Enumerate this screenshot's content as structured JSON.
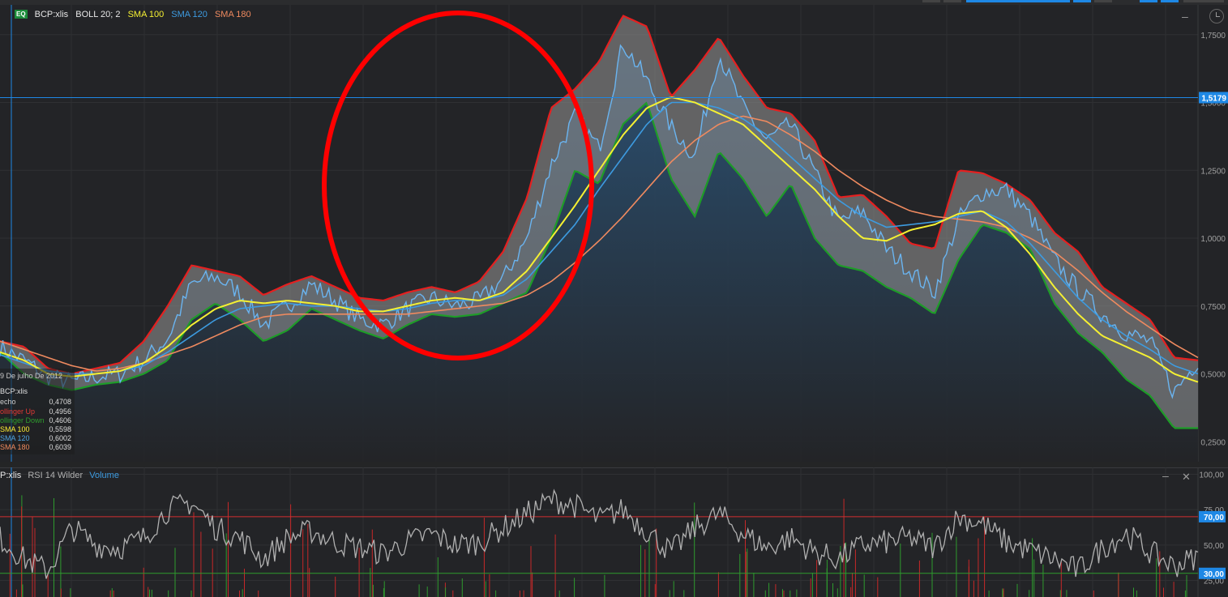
{
  "main_legend": {
    "badge": "EQ",
    "symbol": "BCP:xlis",
    "boll": "BOLL 20; 2",
    "sma100": "SMA 100",
    "sma120": "SMA 120",
    "sma180": "SMA 180"
  },
  "rsi_legend": {
    "symbol": "P:xlis",
    "rsi": "RSI 14 Wilder",
    "volume": "Volume"
  },
  "controls": {
    "minimize": "–",
    "close": "✕"
  },
  "tooltip": {
    "date": "9 De julho De 2012",
    "symbol": "BCP:xlis",
    "rows": [
      {
        "key": "echo",
        "value": "0,4708",
        "color": "#cccccc"
      },
      {
        "key": "ollinger Up",
        "value": "0,4956",
        "color": "#e53935"
      },
      {
        "key": "ollinger Down",
        "value": "0,4606",
        "color": "#2e9b2e"
      },
      {
        "key": "SMA 100",
        "value": "0,5598",
        "color": "#ffee33"
      },
      {
        "key": "SMA 120",
        "value": "0,6002",
        "color": "#4fa3e0"
      },
      {
        "key": "SMA 180",
        "value": "0,6039",
        "color": "#f08a5d"
      }
    ]
  },
  "colors": {
    "price": "#6ab4f0",
    "boll_up": "#e52020",
    "boll_down": "#1e9c28",
    "band_fill": "#8a8a8a",
    "sma100": "#f5f032",
    "sma120": "#3d9be0",
    "sma180": "#ef8a5f",
    "rsi": "#b0b0b0",
    "annotation": "#ff0000",
    "crosshair": "#1e88e5"
  },
  "chart_data": [
    {
      "type": "line",
      "title": "BCP:xlis",
      "ylim": [
        0.2,
        1.8
      ],
      "yticks": [
        "1,7500",
        "1,5000",
        "1,2500",
        "1,0000",
        "0,7500",
        "0,5000",
        "0,2500"
      ],
      "yticks_values": [
        1.75,
        1.5,
        1.25,
        1.0,
        0.75,
        0.5,
        0.25
      ],
      "last_price_label": "1,5179",
      "last_price": 1.5179,
      "x": [
        0,
        2,
        4,
        6,
        8,
        10,
        12,
        14,
        16,
        18,
        20,
        22,
        24,
        26,
        28,
        30,
        32,
        34,
        36,
        38,
        40,
        42,
        44,
        46,
        48,
        50,
        52,
        54,
        56,
        58,
        60,
        62,
        64,
        66,
        68,
        70,
        72,
        74,
        76,
        78,
        80,
        82,
        84,
        86,
        88,
        90,
        92,
        94,
        96,
        98,
        100
      ],
      "series": [
        {
          "name": "BCP:xlis",
          "values": [
            0.6,
            0.55,
            0.49,
            0.47,
            0.49,
            0.5,
            0.55,
            0.63,
            0.83,
            0.86,
            0.8,
            0.68,
            0.75,
            0.83,
            0.77,
            0.7,
            0.68,
            0.74,
            0.78,
            0.75,
            0.77,
            0.85,
            1.0,
            1.27,
            1.45,
            1.33,
            1.72,
            1.58,
            1.41,
            1.3,
            1.68,
            1.48,
            1.36,
            1.42,
            1.24,
            1.06,
            1.1,
            0.96,
            0.88,
            0.8,
            1.07,
            1.17,
            1.18,
            1.08,
            0.92,
            0.81,
            0.72,
            0.65,
            0.62,
            0.43,
            0.55
          ]
        },
        {
          "name": "Bollinger Up",
          "values": [
            0.62,
            0.6,
            0.52,
            0.5,
            0.52,
            0.54,
            0.62,
            0.75,
            0.9,
            0.88,
            0.86,
            0.79,
            0.83,
            0.86,
            0.82,
            0.78,
            0.77,
            0.8,
            0.82,
            0.8,
            0.84,
            0.95,
            1.15,
            1.48,
            1.55,
            1.65,
            1.82,
            1.78,
            1.52,
            1.62,
            1.74,
            1.6,
            1.48,
            1.46,
            1.36,
            1.15,
            1.16,
            1.08,
            0.98,
            0.96,
            1.25,
            1.24,
            1.2,
            1.14,
            1.02,
            0.95,
            0.82,
            0.76,
            0.7,
            0.56,
            0.55
          ]
        },
        {
          "name": "Bollinger Down",
          "values": [
            0.58,
            0.5,
            0.46,
            0.44,
            0.46,
            0.47,
            0.5,
            0.55,
            0.7,
            0.76,
            0.7,
            0.62,
            0.66,
            0.74,
            0.7,
            0.66,
            0.63,
            0.68,
            0.72,
            0.71,
            0.72,
            0.76,
            0.8,
            1.0,
            1.25,
            1.2,
            1.42,
            1.5,
            1.22,
            1.08,
            1.32,
            1.22,
            1.08,
            1.2,
            1.0,
            0.9,
            0.88,
            0.82,
            0.78,
            0.72,
            0.92,
            1.05,
            1.02,
            0.96,
            0.76,
            0.65,
            0.58,
            0.48,
            0.42,
            0.3,
            0.3
          ]
        },
        {
          "name": "SMA 100",
          "values": [
            0.58,
            0.55,
            0.5,
            0.49,
            0.5,
            0.51,
            0.54,
            0.6,
            0.68,
            0.74,
            0.77,
            0.76,
            0.77,
            0.76,
            0.75,
            0.73,
            0.73,
            0.75,
            0.77,
            0.78,
            0.77,
            0.8,
            0.88,
            1.0,
            1.12,
            1.25,
            1.38,
            1.48,
            1.52,
            1.5,
            1.46,
            1.42,
            1.34,
            1.26,
            1.18,
            1.08,
            1.0,
            0.99,
            1.03,
            1.05,
            1.09,
            1.1,
            1.04,
            0.94,
            0.82,
            0.72,
            0.64,
            0.6,
            0.56,
            0.5,
            0.47
          ]
        },
        {
          "name": "SMA 120",
          "values": [
            0.57,
            0.54,
            0.51,
            0.5,
            0.5,
            0.51,
            0.53,
            0.58,
            0.64,
            0.7,
            0.74,
            0.75,
            0.76,
            0.75,
            0.75,
            0.74,
            0.73,
            0.74,
            0.76,
            0.77,
            0.77,
            0.79,
            0.85,
            0.95,
            1.05,
            1.18,
            1.3,
            1.42,
            1.5,
            1.5,
            1.48,
            1.44,
            1.38,
            1.3,
            1.22,
            1.14,
            1.08,
            1.04,
            1.05,
            1.06,
            1.08,
            1.1,
            1.06,
            0.98,
            0.88,
            0.78,
            0.7,
            0.64,
            0.59,
            0.53,
            0.5
          ]
        },
        {
          "name": "SMA 180",
          "values": [
            0.62,
            0.59,
            0.56,
            0.53,
            0.51,
            0.52,
            0.54,
            0.57,
            0.6,
            0.64,
            0.68,
            0.71,
            0.72,
            0.72,
            0.72,
            0.72,
            0.72,
            0.72,
            0.73,
            0.74,
            0.75,
            0.76,
            0.79,
            0.84,
            0.91,
            0.99,
            1.08,
            1.18,
            1.28,
            1.36,
            1.42,
            1.45,
            1.43,
            1.38,
            1.32,
            1.25,
            1.19,
            1.14,
            1.1,
            1.08,
            1.07,
            1.06,
            1.04,
            1.0,
            0.95,
            0.88,
            0.8,
            0.73,
            0.67,
            0.61,
            0.56
          ]
        }
      ]
    },
    {
      "type": "line",
      "title": "RSI 14 Wilder",
      "ylim": [
        15,
        102
      ],
      "yticks": [
        "100,00",
        "75,00",
        "50,00",
        "25,00"
      ],
      "yticks_values": [
        100,
        75,
        50,
        25
      ],
      "overbought_label": "70,00",
      "overbought": 70,
      "oversold_label": "30,00",
      "oversold": 30,
      "x": [
        0,
        2,
        4,
        6,
        8,
        10,
        12,
        14,
        16,
        18,
        20,
        22,
        24,
        26,
        28,
        30,
        32,
        34,
        36,
        38,
        40,
        42,
        44,
        46,
        48,
        50,
        52,
        54,
        56,
        58,
        60,
        62,
        64,
        66,
        68,
        70,
        72,
        74,
        76,
        78,
        80,
        82,
        84,
        86,
        88,
        90,
        92,
        94,
        96,
        98,
        100
      ],
      "series": [
        {
          "name": "RSI 14 Wilder",
          "values": [
            55,
            40,
            32,
            62,
            50,
            48,
            55,
            75,
            80,
            62,
            55,
            40,
            55,
            60,
            52,
            48,
            44,
            52,
            58,
            50,
            52,
            62,
            72,
            82,
            78,
            68,
            75,
            60,
            45,
            62,
            72,
            58,
            48,
            55,
            45,
            40,
            50,
            52,
            55,
            48,
            70,
            65,
            52,
            46,
            40,
            32,
            48,
            58,
            45,
            35,
            42
          ]
        }
      ]
    }
  ]
}
